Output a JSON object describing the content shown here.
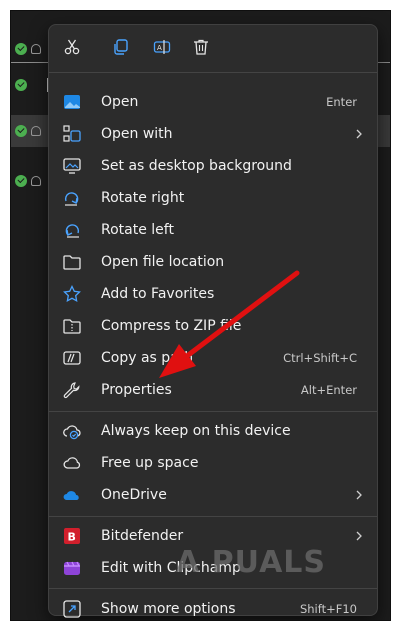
{
  "toolbar": {
    "buttons": [
      "cut-icon",
      "copy-icon",
      "rename-icon",
      "delete-icon"
    ]
  },
  "menu": {
    "groups": [
      [
        {
          "label": "Open",
          "shortcut": "Enter",
          "icon": "photos-icon"
        },
        {
          "label": "Open with",
          "shortcut": "",
          "icon": "open-with-icon",
          "submenu": true
        },
        {
          "label": "Set as desktop background",
          "shortcut": "",
          "icon": "desktop-background-icon"
        },
        {
          "label": "Rotate right",
          "shortcut": "",
          "icon": "rotate-right-icon"
        },
        {
          "label": "Rotate left",
          "shortcut": "",
          "icon": "rotate-left-icon"
        },
        {
          "label": "Open file location",
          "shortcut": "",
          "icon": "folder-icon"
        },
        {
          "label": "Add to Favorites",
          "shortcut": "",
          "icon": "star-icon"
        },
        {
          "label": "Compress to ZIP file",
          "shortcut": "",
          "icon": "zip-icon"
        },
        {
          "label": "Copy as path",
          "shortcut": "Ctrl+Shift+C",
          "icon": "copy-path-icon"
        },
        {
          "label": "Properties",
          "shortcut": "Alt+Enter",
          "icon": "wrench-icon"
        }
      ],
      [
        {
          "label": "Always keep on this device",
          "shortcut": "",
          "icon": "cloud-sync-icon"
        },
        {
          "label": "Free up space",
          "shortcut": "",
          "icon": "cloud-icon"
        },
        {
          "label": "OneDrive",
          "shortcut": "",
          "icon": "onedrive-icon",
          "submenu": true
        }
      ],
      [
        {
          "label": "Bitdefender",
          "shortcut": "",
          "icon": "bitdefender-icon",
          "submenu": true
        },
        {
          "label": "Edit with Clipchamp",
          "shortcut": "",
          "icon": "clipchamp-icon"
        }
      ],
      [
        {
          "label": "Show more options",
          "shortcut": "Shift+F10",
          "icon": "more-options-icon"
        }
      ]
    ]
  },
  "watermark": "A  PUALS",
  "colors": {
    "menu_bg": "#2c2c2c",
    "frame_bg": "#1c1c1c",
    "accent_blue": "#4aa3ff",
    "arrow_red": "#e01010"
  }
}
